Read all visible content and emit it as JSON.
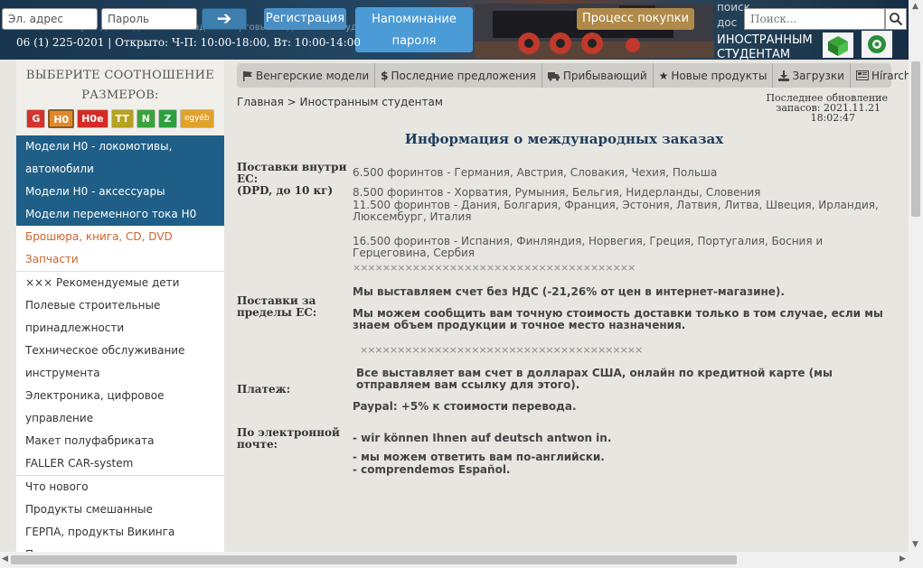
{
  "header": {
    "email_placeholder": "Эл. адрес",
    "password_placeholder": "Пароль",
    "login_arrow": "➔",
    "register_label": "Регистрация",
    "reminder_line1": "Напоминание",
    "reminder_line2": "пароля",
    "purchase_label": "Процесс покупки",
    "top_right_text": "поиск дос",
    "search_placeholder": "Поиск...",
    "contact_line": "06 (1) 225-0201 | Открыто: Ч-П: 10:00-18:00, Вт: 10:00-14:00",
    "faded_line": "Магазин товаров для модельных поездов и торговый отдел - 1016 Буда",
    "foreign_line1": "ИНОСТРАННЫМ",
    "foreign_line2": "СТУДЕНТАМ"
  },
  "sidebar": {
    "scale_title_line1": "ВЫБЕРИТЕ СООТНОШЕНИЕ",
    "scale_title_line2": "РАЗМЕРОВ:",
    "scales": [
      {
        "label": "G",
        "color": "#d3332c"
      },
      {
        "label": "H0",
        "color": "#e0892c"
      },
      {
        "label": "H0e",
        "color": "#d42a26"
      },
      {
        "label": "TT",
        "color": "#b5a21f"
      },
      {
        "label": "N",
        "color": "#3aa43a"
      },
      {
        "label": "Z",
        "color": "#2c9f3e"
      },
      {
        "label": "egyéb",
        "color": "#e2a22a"
      }
    ],
    "dark_items": [
      "Модели H0 - локомотивы,",
      "автомобили",
      "Модели H0 - аксессуары",
      "Модели переменного тока H0"
    ],
    "orange_items": [
      "Брошюра, книга, CD, DVD",
      "Запчасти"
    ],
    "group1": [
      "××× Рекомендуемые дети",
      "Полевые строительные",
      "принадлежности",
      "Техническое обслуживание",
      "инструмента",
      "Электроника, цифровое управление",
      "Макет полуфабриката",
      "FALLER CAR-system"
    ],
    "group2": [
      "Что нового",
      "Продукты смешанные",
      "ГЕРПА, продукты Викинга",
      "Подготовьте свои продукты"
    ]
  },
  "topnav": [
    {
      "label": "Венгерские модели",
      "icon": "flag-icon"
    },
    {
      "label": "Последние предложения",
      "icon": "dollar-icon"
    },
    {
      "label": "Прибывающий",
      "icon": "truck-icon"
    },
    {
      "label": "Новые продукты",
      "icon": "star-icon"
    },
    {
      "label": "Загрузки",
      "icon": "download-icon"
    },
    {
      "label": "Hírarchívum",
      "icon": "newspaper-icon"
    }
  ],
  "breadcrumb": "Главная > Иностранным студентам",
  "update": {
    "label1": "Последнее обновление",
    "label2": "запасов:",
    "date": "2021.11.21",
    "time": "18:02:47"
  },
  "page_title": "Информация о международных заказах",
  "sections": {
    "eu_label1": "Поставки внутри",
    "eu_label2": "ЕС:",
    "eu_label3": "(DPD, до 10 кг)",
    "eu_rate1": "6.500 форинтов - Германия, Австрия, Словакия, Чехия, Польша",
    "eu_rate2": "8.500 форинтов - Хорватия, Румыния, Бельгия, Нидерланды, Словения",
    "eu_rate3": "11.500 форинтов - Дания, Болгария, Франция, Эстония, Латвия, Литва, Швеция, Ирландия, Люксембург, Италия",
    "eu_rate4": "16.500 форинтов - Испания, Финляндия, Норвегия, Греция, Португалия, Босния и Герцеговина, Сербия",
    "separator1": "××××××××××××××××××××××××××××××××××××××",
    "noneu_label1": "Поставки за",
    "noneu_label2": "пределы ЕС:",
    "noneu_text1": "Мы выставляем счет без НДС (-21,26% от цен в интернет-магазине).",
    "noneu_text2": "Мы можем сообщить вам точную стоимость доставки только в том случае, если мы знаем объем продукции и точное место назначения.",
    "separator2": "××××××××××××××××××××××××××××××××××××××",
    "payment_label": "Платеж:",
    "payment_text1": "Все выставляет вам счет в долларах США, онлайн по кредитной карте (мы отправляем вам ссылку для этого).",
    "payment_text2": "Paypal: +5% к стоимости перевода.",
    "email_label1": "По электронной",
    "email_label2": "почте:",
    "email_text1": "- wir können Ihnen auf deutsch antwon in.",
    "email_text2": "- мы можем ответить вам по-английски.",
    "email_text3": "- comprendemos Español."
  }
}
